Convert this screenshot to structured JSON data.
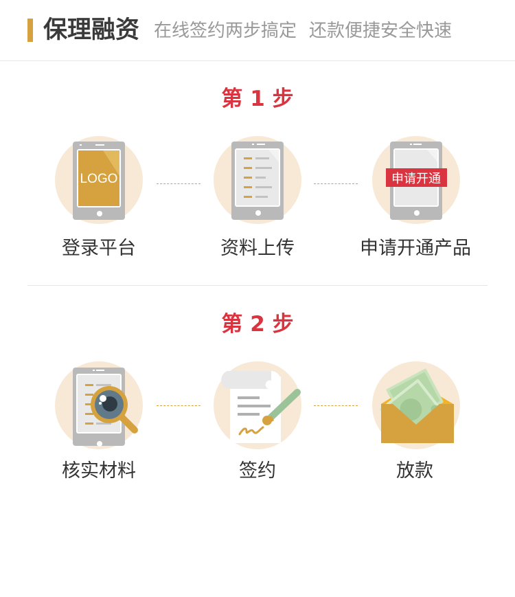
{
  "header": {
    "title": "保理融资",
    "subtitle_1": "在线签约两步搞定",
    "subtitle_2": "还款便捷安全快速"
  },
  "steps": [
    {
      "title": "第 1 步",
      "items": [
        {
          "label": "登录平台",
          "icon": "tablet-logo-icon",
          "icon_text": "LOGO"
        },
        {
          "label": "资料上传",
          "icon": "tablet-document-icon"
        },
        {
          "label": "申请开通产品",
          "icon": "tablet-apply-icon",
          "icon_text": "申请开通"
        }
      ]
    },
    {
      "title": "第 2 步",
      "items": [
        {
          "label": "核实材料",
          "icon": "magnifier-tablet-icon"
        },
        {
          "label": "签约",
          "icon": "contract-pen-icon"
        },
        {
          "label": "放款",
          "icon": "money-envelope-icon"
        }
      ]
    }
  ],
  "colors": {
    "accent_gold": "#d6a23f",
    "step_red": "#d9343f",
    "circle_bg": "#f7e9d6",
    "device_gray": "#b9b9b9"
  }
}
